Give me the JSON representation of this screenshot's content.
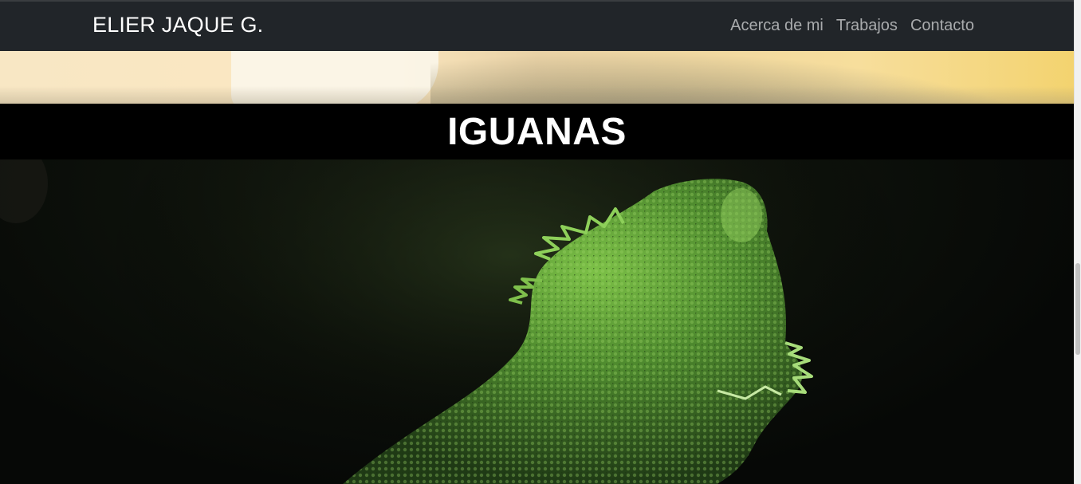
{
  "navbar": {
    "brand": "ELIER JAQUE G.",
    "links": [
      {
        "label": "Acerca de mi"
      },
      {
        "label": "Trabajos"
      },
      {
        "label": "Contacto"
      }
    ]
  },
  "section": {
    "title": "IGUANAS"
  },
  "colors": {
    "navbar_bg": "#212529",
    "title_bar_bg": "#000000",
    "iguana_green": "#5f9e3a"
  }
}
